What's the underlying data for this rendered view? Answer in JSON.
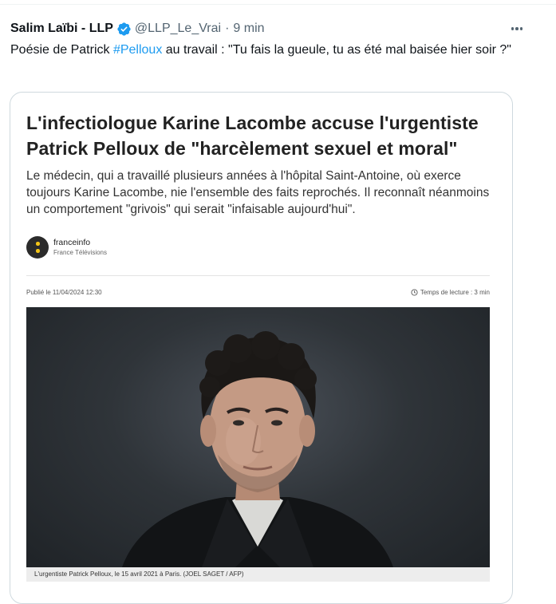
{
  "tweet": {
    "author_name": "Salim Laïbi - LLP",
    "handle": "@LLP_Le_Vrai",
    "separator": "·",
    "time": "9 min",
    "text_before": "Poésie de Patrick ",
    "hashtag": "#Pelloux",
    "text_after": " au travail : \"Tu fais la gueule, tu as été mal baisée hier soir ?\"",
    "accent_color": "#1d9bf0"
  },
  "card": {
    "headline": "L'infectiologue Karine Lacombe accuse l'urgentiste Patrick Pelloux de \"harcèlement sexuel et moral\"",
    "chapo": "Le médecin, qui a travaillé plusieurs années à l'hôpital Saint-Antoine, où exerce toujours Karine Lacombe, nie l'ensemble des faits reprochés. Il reconnaît néanmoins un comportement \"grivois\" qui serait \"infaisable aujourd'hui\".",
    "source_name": "franceinfo",
    "source_sub": "France Télévisions",
    "published": "Publié le 11/04/2024 12:30",
    "reading_time": "Temps de lecture : 3 min",
    "caption": "L'urgentiste Patrick Pelloux, le 15 avril 2021 à Paris. (JOEL SAGET / AFP)"
  }
}
